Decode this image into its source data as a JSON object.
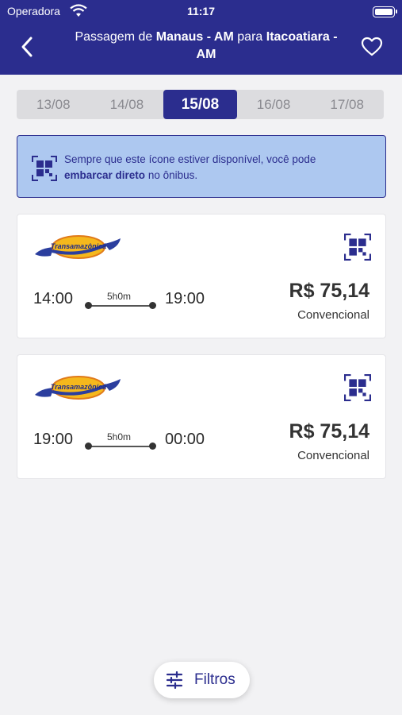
{
  "status_bar": {
    "carrier": "Operadora",
    "time": "11:17"
  },
  "header": {
    "title_prefix": "Passagem de",
    "origin": "Manaus - AM",
    "connector": "para",
    "destination_line1": "Itacoatiara -",
    "destination_line2": "AM"
  },
  "dates": [
    {
      "label": "13/08",
      "active": false
    },
    {
      "label": "14/08",
      "active": false
    },
    {
      "label": "15/08",
      "active": true
    },
    {
      "label": "16/08",
      "active": false
    },
    {
      "label": "17/08",
      "active": false
    }
  ],
  "info_banner": {
    "text_before": "Sempre que este ícone estiver disponível, você pode",
    "text_bold": "embarcar direto",
    "text_after": "no ônibus."
  },
  "trips": [
    {
      "departure": "14:00",
      "duration": "5h0m",
      "arrival": "19:00",
      "price": "R$ 75,14",
      "class": "Convencional"
    },
    {
      "departure": "19:00",
      "duration": "5h0m",
      "arrival": "00:00",
      "price": "R$ 75,14",
      "class": "Convencional"
    }
  ],
  "filter_button": {
    "label": "Filtros"
  },
  "colors": {
    "brand": "#2b2d8e",
    "info_bg": "#adc8f0",
    "background": "#f2f2f4"
  }
}
